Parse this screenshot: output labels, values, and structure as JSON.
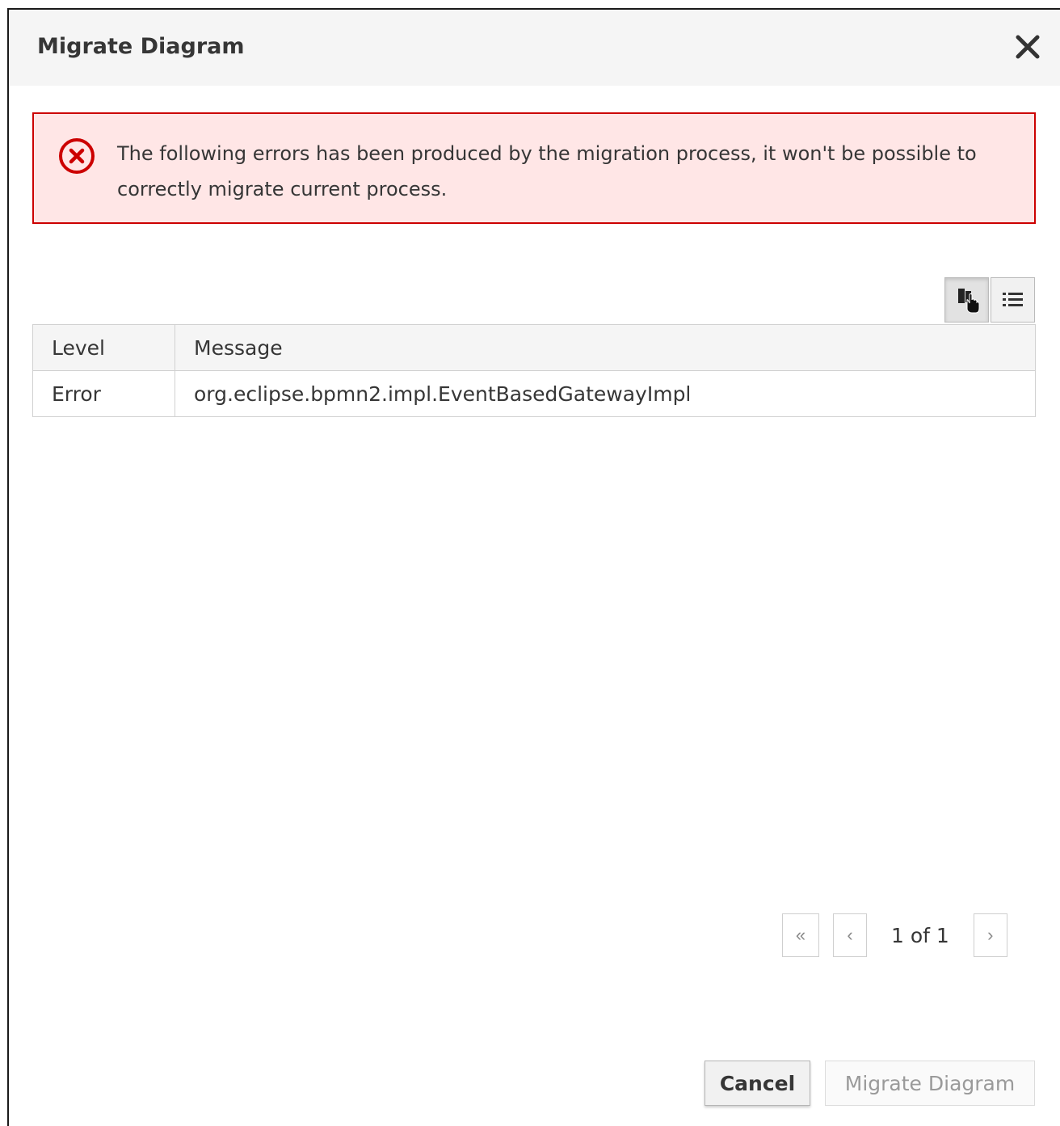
{
  "dialog": {
    "title": "Migrate Diagram",
    "close_icon": "close-icon"
  },
  "alert": {
    "icon": "error-circle-icon",
    "message": "The following errors has been produced by the migration process, it won't be possible to correctly migrate current process.",
    "accent_color": "#cc0000",
    "background_color": "#ffe6e6"
  },
  "toolbar": {
    "buttons": [
      {
        "icon": "column-picker-icon",
        "active": true
      },
      {
        "icon": "list-view-icon",
        "active": false
      }
    ]
  },
  "table": {
    "columns": [
      "Level",
      "Message"
    ],
    "rows": [
      {
        "level": "Error",
        "message": "org.eclipse.bpmn2.impl.EventBasedGatewayImpl"
      }
    ]
  },
  "pagination": {
    "first_icon": "double-chevron-left-icon",
    "prev_icon": "chevron-left-icon",
    "next_icon": "chevron-right-icon",
    "page_text": "1 of 1"
  },
  "footer": {
    "cancel_label": "Cancel",
    "migrate_label": "Migrate Diagram"
  }
}
